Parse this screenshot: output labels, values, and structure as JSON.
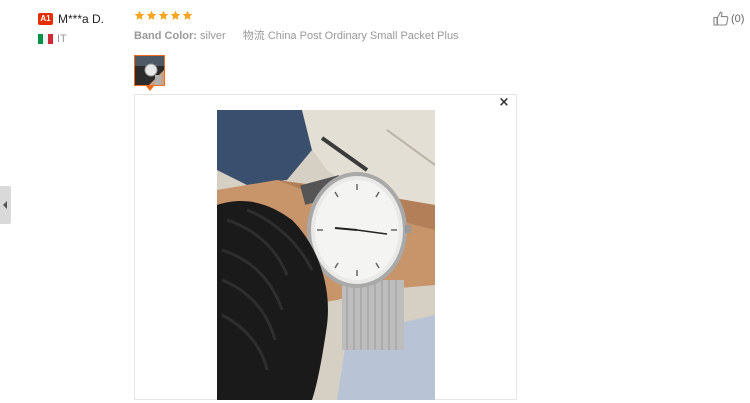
{
  "reviewer": {
    "badge": "A1",
    "name": "M***a D.",
    "country": "IT",
    "flag_colors": [
      "#009246",
      "#ffffff",
      "#ce2b37"
    ]
  },
  "review": {
    "rating": 5,
    "rating_max": 5,
    "star_color": "#f5a623",
    "attributes": [
      {
        "label": "Band Color:",
        "value": "silver"
      },
      {
        "label": "物流",
        "value": "China Post Ordinary Small Packet Plus"
      }
    ]
  },
  "helpful": {
    "icon": "thumbs-up-icon",
    "count": "(0)"
  },
  "gallery": {
    "thumbnail_icon": "photo-thumbnail",
    "close_label": "×",
    "image_alt": "wristwatch on wrist"
  },
  "nav": {
    "left_arrow_icon": "chevron-left-icon"
  },
  "colors": {
    "accent": "#f56b1d",
    "badge": "#e62e04"
  }
}
